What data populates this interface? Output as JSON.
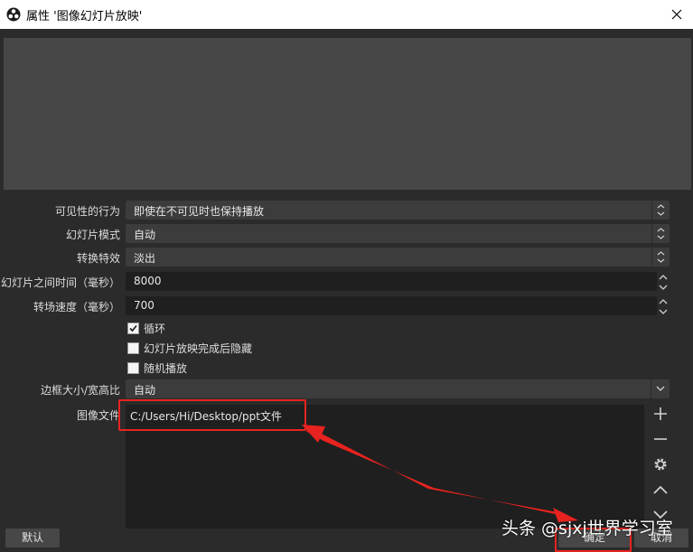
{
  "window": {
    "title": "属性 '图像幻灯片放映'"
  },
  "properties": {
    "visibility_behavior": {
      "label": "可见性的行为",
      "value": "即使在不可见时也保持播放"
    },
    "slide_mode": {
      "label": "幻灯片模式",
      "value": "自动"
    },
    "transition": {
      "label": "转换特效",
      "value": "淡出"
    },
    "slide_time": {
      "label": "幻灯片之间时间（毫秒）",
      "value": "8000"
    },
    "transition_speed": {
      "label": "转场速度（毫秒）",
      "value": "700"
    },
    "loop": {
      "label": "循环",
      "checked": true
    },
    "hide_when_done": {
      "label": "幻灯片放映完成后隐藏",
      "checked": false
    },
    "random": {
      "label": "随机播放",
      "checked": false
    },
    "bounding_size": {
      "label": "边框大小/宽高比",
      "value": "自动"
    },
    "image_files": {
      "label": "图像文件",
      "items": [
        "C:/Users/Hi/Desktop/ppt文件"
      ]
    }
  },
  "footer": {
    "default_label": "默认",
    "ok_label": "确定",
    "cancel_label": "取消"
  },
  "watermark": {
    "text": "头条 @sjxj世界学习室"
  },
  "colors": {
    "accent_annotation": "#e8231f",
    "panel": "#2b2b2b",
    "preview": "#474747"
  }
}
